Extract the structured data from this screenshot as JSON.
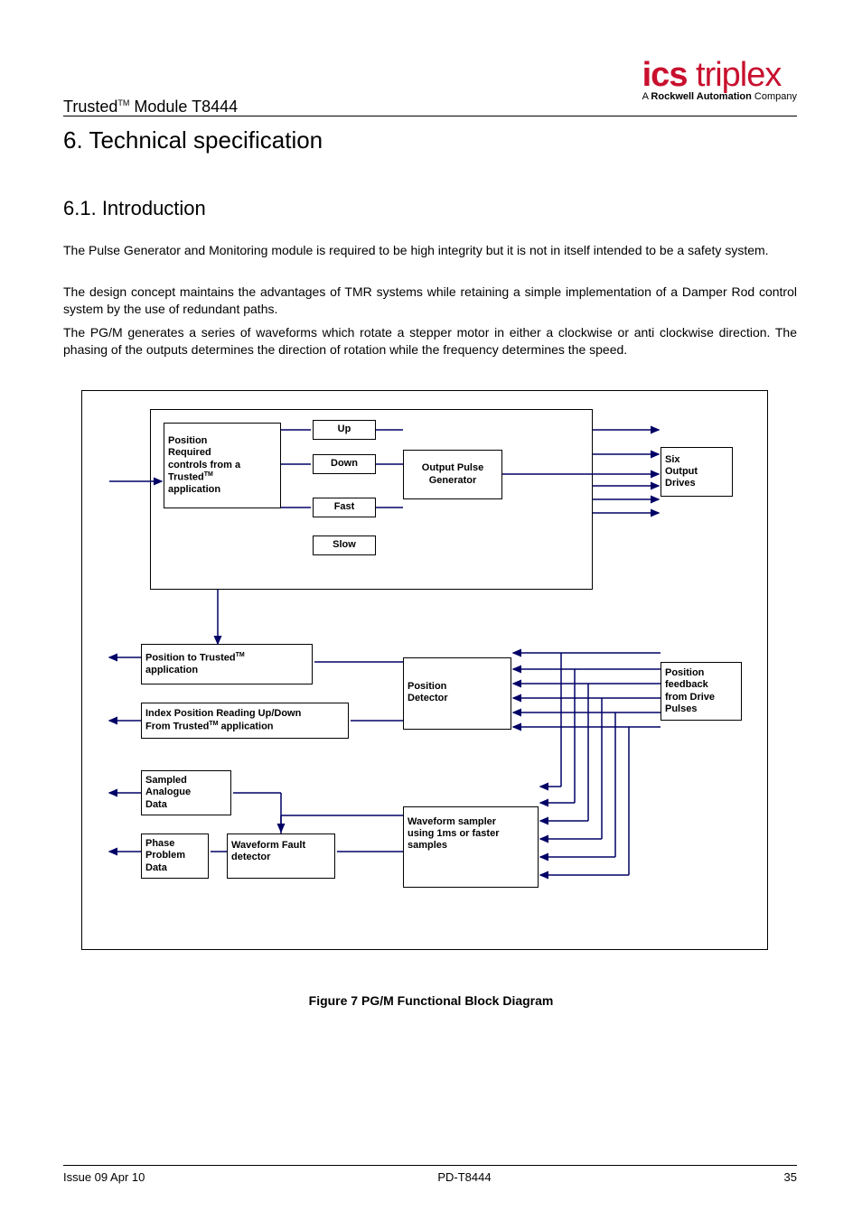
{
  "header": {
    "product_line": "Trusted",
    "tm": "TM",
    "module": " Module T8444",
    "logo_bold": "ics",
    "logo_light": " triplex",
    "logo_sub_prefix": "A ",
    "logo_sub_bold": "Rockwell Automation",
    "logo_sub_suffix": " Company"
  },
  "section": {
    "number": "6.",
    "title": "  Technical specification",
    "sub_number": "6.1.",
    "sub_title": " Introduction"
  },
  "paragraphs": {
    "p1": "The Pulse Generator and Monitoring module is required to be high integrity but it is not in itself intended to be a safety system.",
    "p2": "The design concept maintains the advantages of TMR systems while retaining a simple implementation of a Damper Rod control system by the use of redundant paths.",
    "p3": "The PG/M generates a series of waveforms which rotate a stepper motor in either a clockwise or anti clockwise direction.  The phasing of the outputs determines the direction of rotation while the frequency determines the speed."
  },
  "diagram": {
    "controls_box_l1": "Position",
    "controls_box_l2": "Required",
    "controls_box_l3": "controls from a",
    "controls_box_l4": "Trusted",
    "controls_box_tm": "TM",
    "controls_box_l5": "application",
    "btn_up": "Up",
    "btn_down": "Down",
    "btn_fast": "Fast",
    "btn_slow": "Slow",
    "output_pulse_l1": "Output Pulse",
    "output_pulse_l2": "Generator",
    "six_out_l1": "Six",
    "six_out_l2": "Output",
    "six_out_l3": "Drives",
    "pos_to_l1": "Position to Trusted",
    "pos_to_tm": "TM",
    "pos_to_l2": "application",
    "index_l1": "Index Position Reading Up/Down",
    "index_l2": "From Trusted",
    "index_tm": "TM",
    "index_l3": " application",
    "pos_det_l1": "Position",
    "pos_det_l2": "Detector",
    "pos_fb_l1": "Position",
    "pos_fb_l2": "feedback",
    "pos_fb_l3": "from Drive",
    "pos_fb_l4": "Pulses",
    "sampled_l1": "Sampled",
    "sampled_l2": "Analogue",
    "sampled_l3": "Data",
    "phase_l1": "Phase",
    "phase_l2": "Problem",
    "phase_l3": "Data",
    "wave_fault_l1": "Waveform Fault",
    "wave_fault_l2": "detector",
    "wave_samp_l1": "Waveform sampler",
    "wave_samp_l2": "using 1ms or faster",
    "wave_samp_l3": "samples"
  },
  "caption": "Figure 7 PG/M Functional Block Diagram",
  "footer": {
    "left": "Issue 09 Apr 10",
    "center": "PD-T8444",
    "right": "35"
  }
}
